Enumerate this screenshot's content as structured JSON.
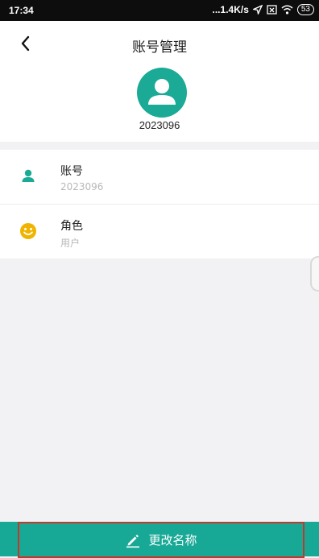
{
  "status_bar": {
    "time": "17:34",
    "speed": "...1.4K/s",
    "battery": "53"
  },
  "header": {
    "title": "账号管理",
    "username": "2023096"
  },
  "rows": [
    {
      "label": "账号",
      "value": "2023096",
      "icon": "person-icon",
      "icon_color": "#1aaa96"
    },
    {
      "label": "角色",
      "value": "用户",
      "icon": "smiley-icon",
      "icon_color": "#f0b400"
    }
  ],
  "footer": {
    "rename_label": "更改名称"
  },
  "colors": {
    "primary": "#1aaa96",
    "highlight_border": "#c0392b"
  }
}
